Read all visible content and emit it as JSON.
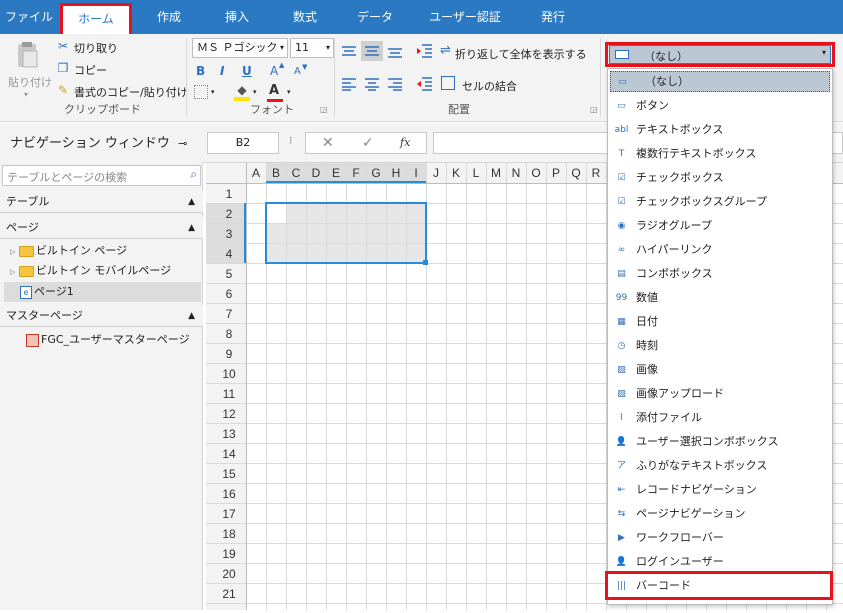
{
  "tabs": [
    "ファイル",
    "ホーム",
    "作成",
    "挿入",
    "数式",
    "データ",
    "ユーザー認証",
    "発行"
  ],
  "active_tab": "ホーム",
  "ribbon": {
    "paste_label": "貼り付け",
    "cut_label": "切り取り",
    "copy_label": "コピー",
    "format_copy_label": "書式のコピー/貼り付け",
    "clipboard_group": "クリップボード",
    "font_name": "ＭＳ Ｐゴシック",
    "font_size": "11",
    "font_group": "フォント",
    "bold": "B",
    "italic": "I",
    "underline": "U",
    "grow_font": "A",
    "shrink_font": "A",
    "font_color": "A",
    "wrap_text_label": "折り返して全体を表示する",
    "merge_cells_label": "セルの結合",
    "alignment_group": "配置",
    "control_select_value": "（なし）"
  },
  "nav": {
    "title": "ナビゲーション ウィンドウ",
    "search_placeholder": "テーブルとページの検索",
    "sections": {
      "table": "テーブル",
      "page": "ページ",
      "master": "マスターページ"
    },
    "page_items": [
      "ビルトイン ページ",
      "ビルトイン モバイルページ",
      "ページ1"
    ],
    "master_items": [
      "FGC_ユーザーマスターページ"
    ]
  },
  "formula_bar": {
    "cell_ref": "B2",
    "fx": "fx",
    "cancel": "✕",
    "confirm": "✓"
  },
  "grid": {
    "columns": [
      "A",
      "B",
      "C",
      "D",
      "E",
      "F",
      "G",
      "H",
      "I",
      "J",
      "K",
      "L",
      "M",
      "N",
      "O",
      "P",
      "Q",
      "R"
    ],
    "rows": [
      "1",
      "2",
      "3",
      "4",
      "5",
      "6",
      "7",
      "8",
      "9",
      "10",
      "11",
      "12",
      "13",
      "14",
      "15",
      "16",
      "17",
      "18",
      "19",
      "20",
      "21"
    ],
    "selected_range": "B2:I4"
  },
  "dropdown": {
    "items": [
      {
        "label": "（なし）",
        "icon": "rect-icon"
      },
      {
        "label": "ボタン",
        "icon": "button-icon"
      },
      {
        "label": "テキストボックス",
        "icon": "textbox-icon"
      },
      {
        "label": "複数行テキストボックス",
        "icon": "multiline-textbox-icon"
      },
      {
        "label": "チェックボックス",
        "icon": "checkbox-icon"
      },
      {
        "label": "チェックボックスグループ",
        "icon": "checkbox-group-icon"
      },
      {
        "label": "ラジオグループ",
        "icon": "radio-icon"
      },
      {
        "label": "ハイパーリンク",
        "icon": "link-icon"
      },
      {
        "label": "コンボボックス",
        "icon": "combobox-icon"
      },
      {
        "label": "数値",
        "icon": "number-icon"
      },
      {
        "label": "日付",
        "icon": "calendar-icon"
      },
      {
        "label": "時刻",
        "icon": "clock-icon"
      },
      {
        "label": "画像",
        "icon": "image-icon"
      },
      {
        "label": "画像アップロード",
        "icon": "image-upload-icon"
      },
      {
        "label": "添付ファイル",
        "icon": "attachment-icon"
      },
      {
        "label": "ユーザー選択コンボボックス",
        "icon": "user-combobox-icon"
      },
      {
        "label": "ふりがなテキストボックス",
        "icon": "furigana-icon"
      },
      {
        "label": "レコードナビゲーション",
        "icon": "record-nav-icon"
      },
      {
        "label": "ページナビゲーション",
        "icon": "page-nav-icon"
      },
      {
        "label": "ワークフローバー",
        "icon": "workflow-icon"
      },
      {
        "label": "ログインユーザー",
        "icon": "login-user-icon"
      },
      {
        "label": "バーコード",
        "icon": "barcode-icon"
      }
    ],
    "icon_glyphs": [
      "▭",
      "▭",
      "abl",
      "T",
      "☑",
      "☑",
      "◉",
      "∞",
      "▤",
      "99",
      "▦",
      "◷",
      "▨",
      "▨",
      "⌇",
      "👤",
      "ア",
      "⇤",
      "⇆",
      "▶",
      "👤",
      "|||"
    ]
  },
  "colors": {
    "accent": "#2b79c2",
    "highlight": "#e8121d",
    "selection_fill": "#e6e6e6",
    "selection_border": "#2b8ad6"
  }
}
